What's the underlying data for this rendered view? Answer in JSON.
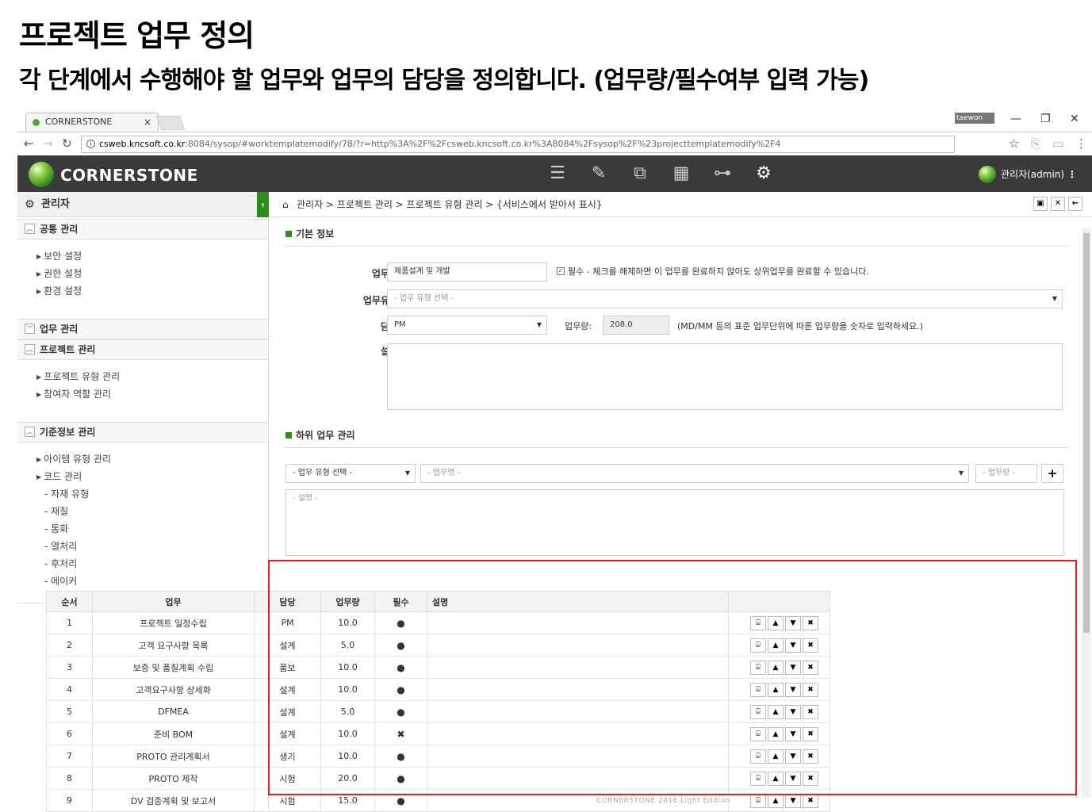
{
  "slide": {
    "title": "프로젝트 업무 정의",
    "subtitle": "각 단계에서 수행해야 할 업무와 업무의 담당을 정의합니다. (업무량/필수여부 입력 가능)"
  },
  "browser": {
    "tab_title": "CORNERSTONE",
    "user_chip": "taewon lee",
    "url_host": "csweb.kncsoft.co.kr",
    "url_path": ":8084/sysop/#worktemplatemodify/78/?r=http%3A%2F%2Fcsweb.kncsoft.co.kr%3A8084%2Fsysop%2F%23projecttemplatemodify%2F4"
  },
  "app": {
    "logo": "CORNERSTONE",
    "admin": "관리자(admin)",
    "accent": "#2e8b1e"
  },
  "sidebar": {
    "header": "관리자",
    "groups": [
      {
        "label": "공통 관리",
        "items": [
          "보안 설정",
          "권한 설정",
          "환경 설정"
        ]
      },
      {
        "label": "업무 관리"
      },
      {
        "label": "프로젝트 관리",
        "items": [
          "프로젝트 유형 관리",
          "참여자 역할 관리"
        ]
      },
      {
        "label": "기준정보 관리",
        "items": [
          "아이템 유형 관리",
          "코드 관리"
        ],
        "subitems": [
          "- 자재 유형",
          "- 재질",
          "- 통화",
          "- 열처리",
          "- 후처리",
          "- 메이커"
        ]
      }
    ]
  },
  "breadcrumb": "관리자 > 프로젝트 관리 > 프로젝트 유형 관리 > {서비스에서 받아서 표시}",
  "basic": {
    "section": "기본 정보",
    "name_label": "업무명",
    "name_value": "제품설계 및 개발",
    "required_text": "필수 - 체크를 해제하면 이 업무를 완료하지 않아도 상위업무를 완료할 수 있습니다.",
    "type_label": "업무유형",
    "type_placeholder": "- 업무 유형 선택 -",
    "owner_label": "담당",
    "owner_value": "PM",
    "workload_label": "업무량:",
    "workload_value": "208.0",
    "workload_hint": "(MD/MM 등의 표준 업무단위에 따른 업무량을 숫자로 입력하세요.)",
    "desc_label": "설명"
  },
  "sub": {
    "section": "하위 업무 관리",
    "type_placeholder": "- 업무 유형 선택 -",
    "name_placeholder": "- 업무명 -",
    "workload_placeholder": "- 업무량 -",
    "desc_placeholder": "- 설명 -",
    "add": "+"
  },
  "table": {
    "headers": {
      "seq": "순서",
      "task": "업무",
      "owner": "담당",
      "workload": "업무량",
      "required": "필수",
      "desc": "설명"
    },
    "rows": [
      {
        "seq": "1",
        "task": "프로젝트 일정수립",
        "owner": "PM",
        "workload": "10.0",
        "required": "●"
      },
      {
        "seq": "2",
        "task": "고객 요구사항 목록",
        "owner": "설계",
        "workload": "5.0",
        "required": "●"
      },
      {
        "seq": "3",
        "task": "보증 및 품질계획 수립",
        "owner": "품보",
        "workload": "10.0",
        "required": "●"
      },
      {
        "seq": "4",
        "task": "고객요구사항 상세화",
        "owner": "설계",
        "workload": "10.0",
        "required": "●"
      },
      {
        "seq": "5",
        "task": "DFMEA",
        "owner": "설계",
        "workload": "5.0",
        "required": "●"
      },
      {
        "seq": "6",
        "task": "준비 BOM",
        "owner": "설계",
        "workload": "10.0",
        "required": "✖"
      },
      {
        "seq": "7",
        "task": "PROTO 관리계획서",
        "owner": "생기",
        "workload": "10.0",
        "required": "●"
      },
      {
        "seq": "8",
        "task": "PROTO 제작",
        "owner": "시험",
        "workload": "20.0",
        "required": "●"
      },
      {
        "seq": "9",
        "task": "DV 검증계획 및 보고서",
        "owner": "시험",
        "workload": "15.0",
        "required": "●"
      }
    ]
  },
  "footer": "CORNERSTONE 2016 Light Edition"
}
